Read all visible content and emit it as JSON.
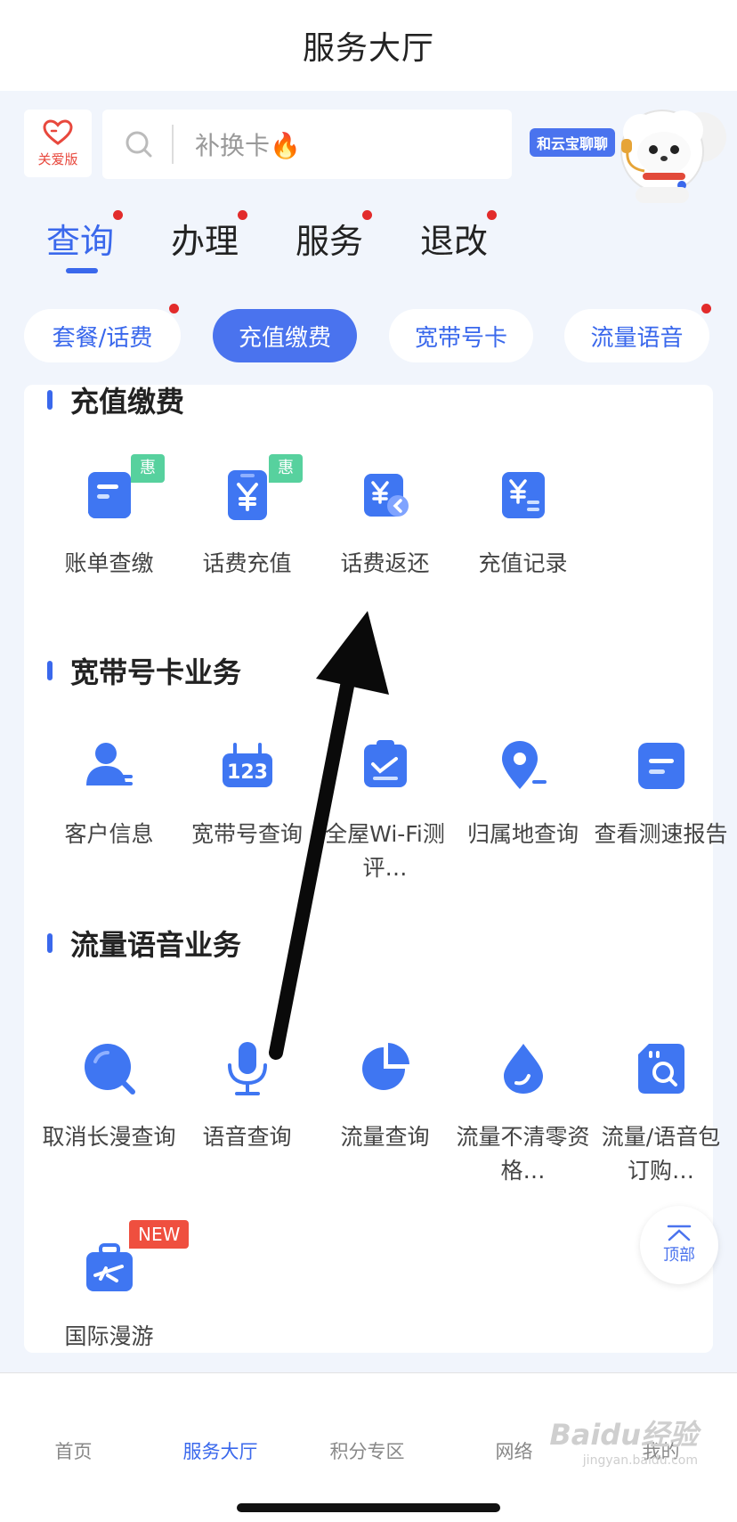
{
  "header": {
    "title": "服务大厅"
  },
  "care_mode": {
    "label": "关爱版"
  },
  "search": {
    "placeholder": "补换卡🔥"
  },
  "assistant": {
    "chat_label": "和云宝聊聊"
  },
  "main_tabs": [
    {
      "label": "查询",
      "active": true,
      "has_dot": true
    },
    {
      "label": "办理",
      "active": false,
      "has_dot": true
    },
    {
      "label": "服务",
      "active": false,
      "has_dot": true
    },
    {
      "label": "退改",
      "active": false,
      "has_dot": true
    }
  ],
  "pills": [
    {
      "label": "套餐/话费",
      "active": false,
      "has_dot": true
    },
    {
      "label": "充值缴费",
      "active": true,
      "has_dot": false
    },
    {
      "label": "宽带号卡",
      "active": false,
      "has_dot": false
    },
    {
      "label": "流量语音",
      "active": false,
      "has_dot": true
    }
  ],
  "sections": [
    {
      "title": "充值缴费",
      "items": [
        {
          "label": "账单查缴",
          "icon": "bill-icon",
          "badge": "惠"
        },
        {
          "label": "话费充值",
          "icon": "phone-yuan-icon",
          "badge": "惠"
        },
        {
          "label": "话费返还",
          "icon": "yuan-return-icon"
        },
        {
          "label": "充值记录",
          "icon": "yuan-record-icon"
        }
      ]
    },
    {
      "title": "宽带号卡业务",
      "items": [
        {
          "label": "客户信息",
          "icon": "user-info-icon"
        },
        {
          "label": "宽带号查询",
          "icon": "router-123-icon"
        },
        {
          "label": "全屋Wi-Fi测评…",
          "icon": "clipboard-check-icon"
        },
        {
          "label": "归属地查询",
          "icon": "location-pin-icon"
        },
        {
          "label": "查看测速报告",
          "icon": "report-icon"
        }
      ]
    },
    {
      "title": "流量语音业务",
      "items": [
        {
          "label": "取消长漫查询",
          "icon": "chat-bubble-icon"
        },
        {
          "label": "语音查询",
          "icon": "microphone-icon"
        },
        {
          "label": "流量查询",
          "icon": "pie-chart-icon"
        },
        {
          "label": "流量不清零资格…",
          "icon": "water-drop-icon"
        },
        {
          "label": "流量/语音包订购…",
          "icon": "sim-search-icon"
        },
        {
          "label": "国际漫游",
          "icon": "suitcase-plane-icon",
          "badge": "NEW"
        }
      ]
    }
  ],
  "to_top": {
    "label": "顶部"
  },
  "bottom_nav": [
    {
      "label": "首页",
      "active": false
    },
    {
      "label": "服务大厅",
      "active": true
    },
    {
      "label": "积分专区",
      "active": false
    },
    {
      "label": "网络",
      "active": false
    },
    {
      "label": "我的",
      "active": false
    }
  ],
  "watermark": {
    "text": "Baidu经验",
    "sub": "jingyan.baidu.com"
  },
  "colors": {
    "accent": "#3a68ec",
    "dot": "#e22b2b",
    "badge_green": "#57d19e",
    "badge_red": "#ef4f3f"
  }
}
